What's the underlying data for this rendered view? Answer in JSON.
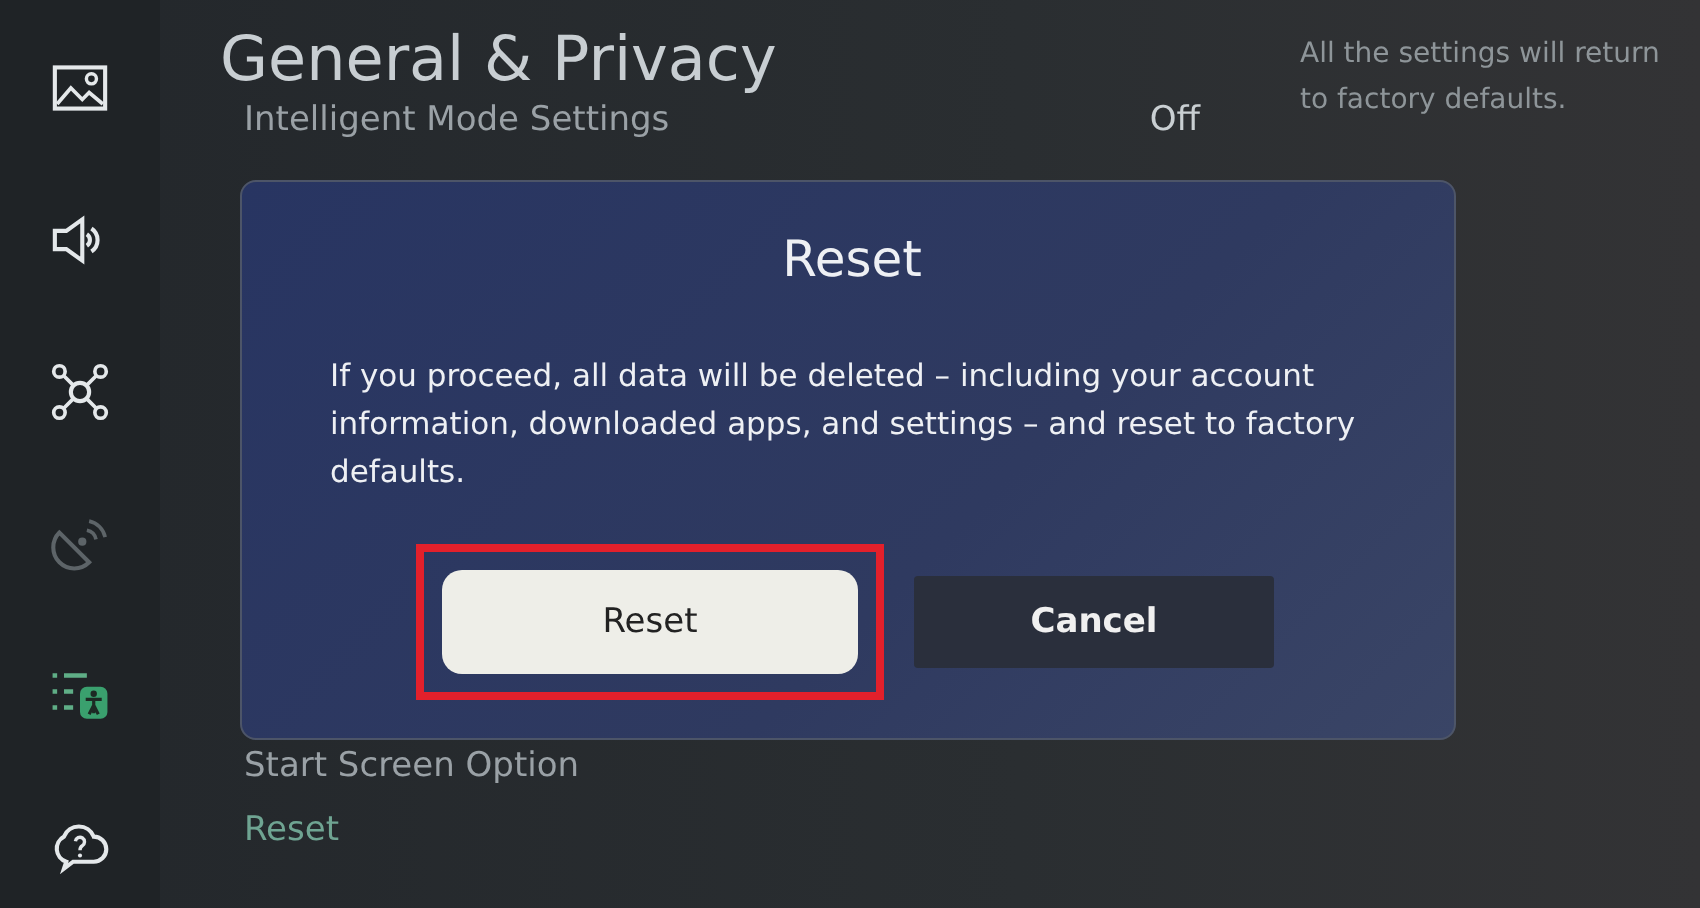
{
  "sidebar": {
    "items": [
      {
        "kind": "picture",
        "selected": false,
        "disabled": false
      },
      {
        "kind": "sound",
        "selected": false,
        "disabled": false
      },
      {
        "kind": "connection",
        "selected": false,
        "disabled": false
      },
      {
        "kind": "broadcast",
        "selected": false,
        "disabled": true
      },
      {
        "kind": "general",
        "selected": true,
        "disabled": false
      },
      {
        "kind": "support",
        "selected": false,
        "disabled": false
      }
    ]
  },
  "page": {
    "title": "General & Privacy",
    "items": [
      {
        "label": "Intelligent Mode Settings",
        "value": "Off",
        "selected": false
      },
      {
        "label": "Start Screen Option",
        "selected": false
      },
      {
        "label": "Reset",
        "selected": true
      }
    ],
    "hint": "All the settings will return to factory defaults."
  },
  "dialog": {
    "title": "Reset",
    "message": "If you proceed, all data will be deleted – including your account information, downloaded apps, and settings – and reset to factory defaults.",
    "buttons": [
      {
        "label": "Reset",
        "selected": true,
        "highlighted": true
      },
      {
        "label": "Cancel",
        "selected": false,
        "highlighted": false
      }
    ]
  }
}
